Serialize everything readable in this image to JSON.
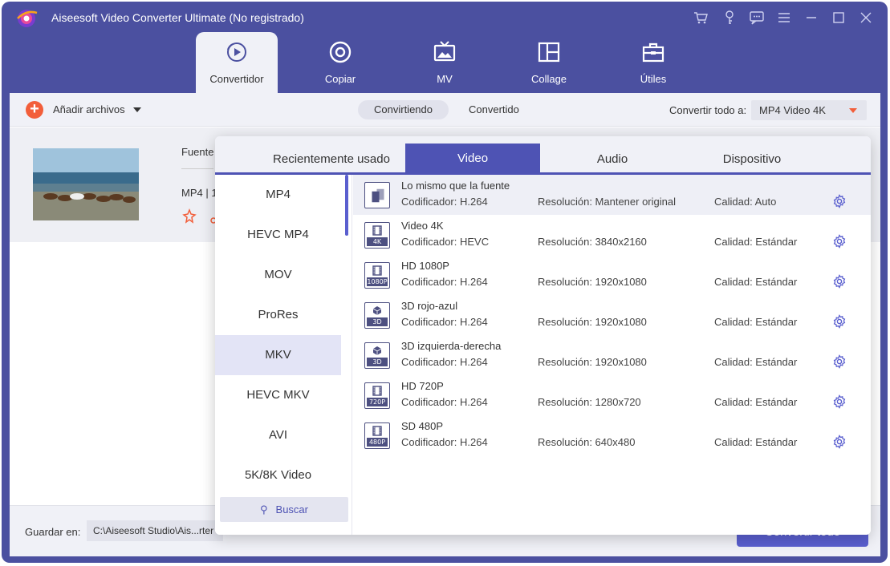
{
  "window": {
    "title": "Aiseesoft Video Converter Ultimate (No registrado)"
  },
  "nav": {
    "tabs": [
      {
        "label": "Convertidor",
        "icon": "converter-icon",
        "active": true
      },
      {
        "label": "Copiar",
        "icon": "disc-icon",
        "active": false
      },
      {
        "label": "MV",
        "icon": "mv-icon",
        "active": false
      },
      {
        "label": "Collage",
        "icon": "collage-icon",
        "active": false
      },
      {
        "label": "Útiles",
        "icon": "toolbox-icon",
        "active": false
      }
    ]
  },
  "toolbar": {
    "add_files": "Añadir archivos",
    "segments": [
      "Convirtiendo",
      "Convertido"
    ],
    "convert_all_label": "Convertir todo a:",
    "convert_all_value": "MP4 Video 4K"
  },
  "file": {
    "source_label": "Fuente",
    "meta": "MP4 | 1"
  },
  "bottom": {
    "save_label": "Guardar en:",
    "save_path": "C:\\Aiseesoft Studio\\Ais...rter",
    "convert_button": "Convertir todo"
  },
  "popup": {
    "tabs": [
      "Recientemente usado",
      "Video",
      "Audio",
      "Dispositivo"
    ],
    "active_tab": "Video",
    "categories": [
      "MP4",
      "HEVC MP4",
      "MOV",
      "ProRes",
      "MKV",
      "HEVC MKV",
      "AVI",
      "5K/8K Video"
    ],
    "active_category": "MKV",
    "search_label": "Buscar",
    "formats": [
      {
        "name": "Lo mismo que la fuente",
        "encoder": "Codificador: H.264",
        "resolution": "Resolución: Mantener original",
        "quality": "Calidad: Auto",
        "badge": "",
        "icon": "same-as-source-icon"
      },
      {
        "name": "Video 4K",
        "encoder": "Codificador: HEVC",
        "resolution": "Resolución: 3840x2160",
        "quality": "Calidad: Estándar",
        "badge": "4K",
        "icon": "film-icon"
      },
      {
        "name": "HD 1080P",
        "encoder": "Codificador: H.264",
        "resolution": "Resolución: 1920x1080",
        "quality": "Calidad: Estándar",
        "badge": "1080P",
        "icon": "film-icon"
      },
      {
        "name": "3D rojo-azul",
        "encoder": "Codificador: H.264",
        "resolution": "Resolución: 1920x1080",
        "quality": "Calidad: Estándar",
        "badge": "3D",
        "icon": "cube-icon"
      },
      {
        "name": "3D izquierda-derecha",
        "encoder": "Codificador: H.264",
        "resolution": "Resolución: 1920x1080",
        "quality": "Calidad: Estándar",
        "badge": "3D",
        "icon": "cube-icon"
      },
      {
        "name": "HD 720P",
        "encoder": "Codificador: H.264",
        "resolution": "Resolución: 1280x720",
        "quality": "Calidad: Estándar",
        "badge": "720P",
        "icon": "film-icon"
      },
      {
        "name": "SD 480P",
        "encoder": "Codificador: H.264",
        "resolution": "Resolución: 640x480",
        "quality": "Calidad: Estándar",
        "badge": "480P",
        "icon": "film-icon"
      }
    ]
  },
  "colors": {
    "accent": "#4e53b4",
    "titlebar": "#4b50a0",
    "orange": "#f25e3a"
  }
}
